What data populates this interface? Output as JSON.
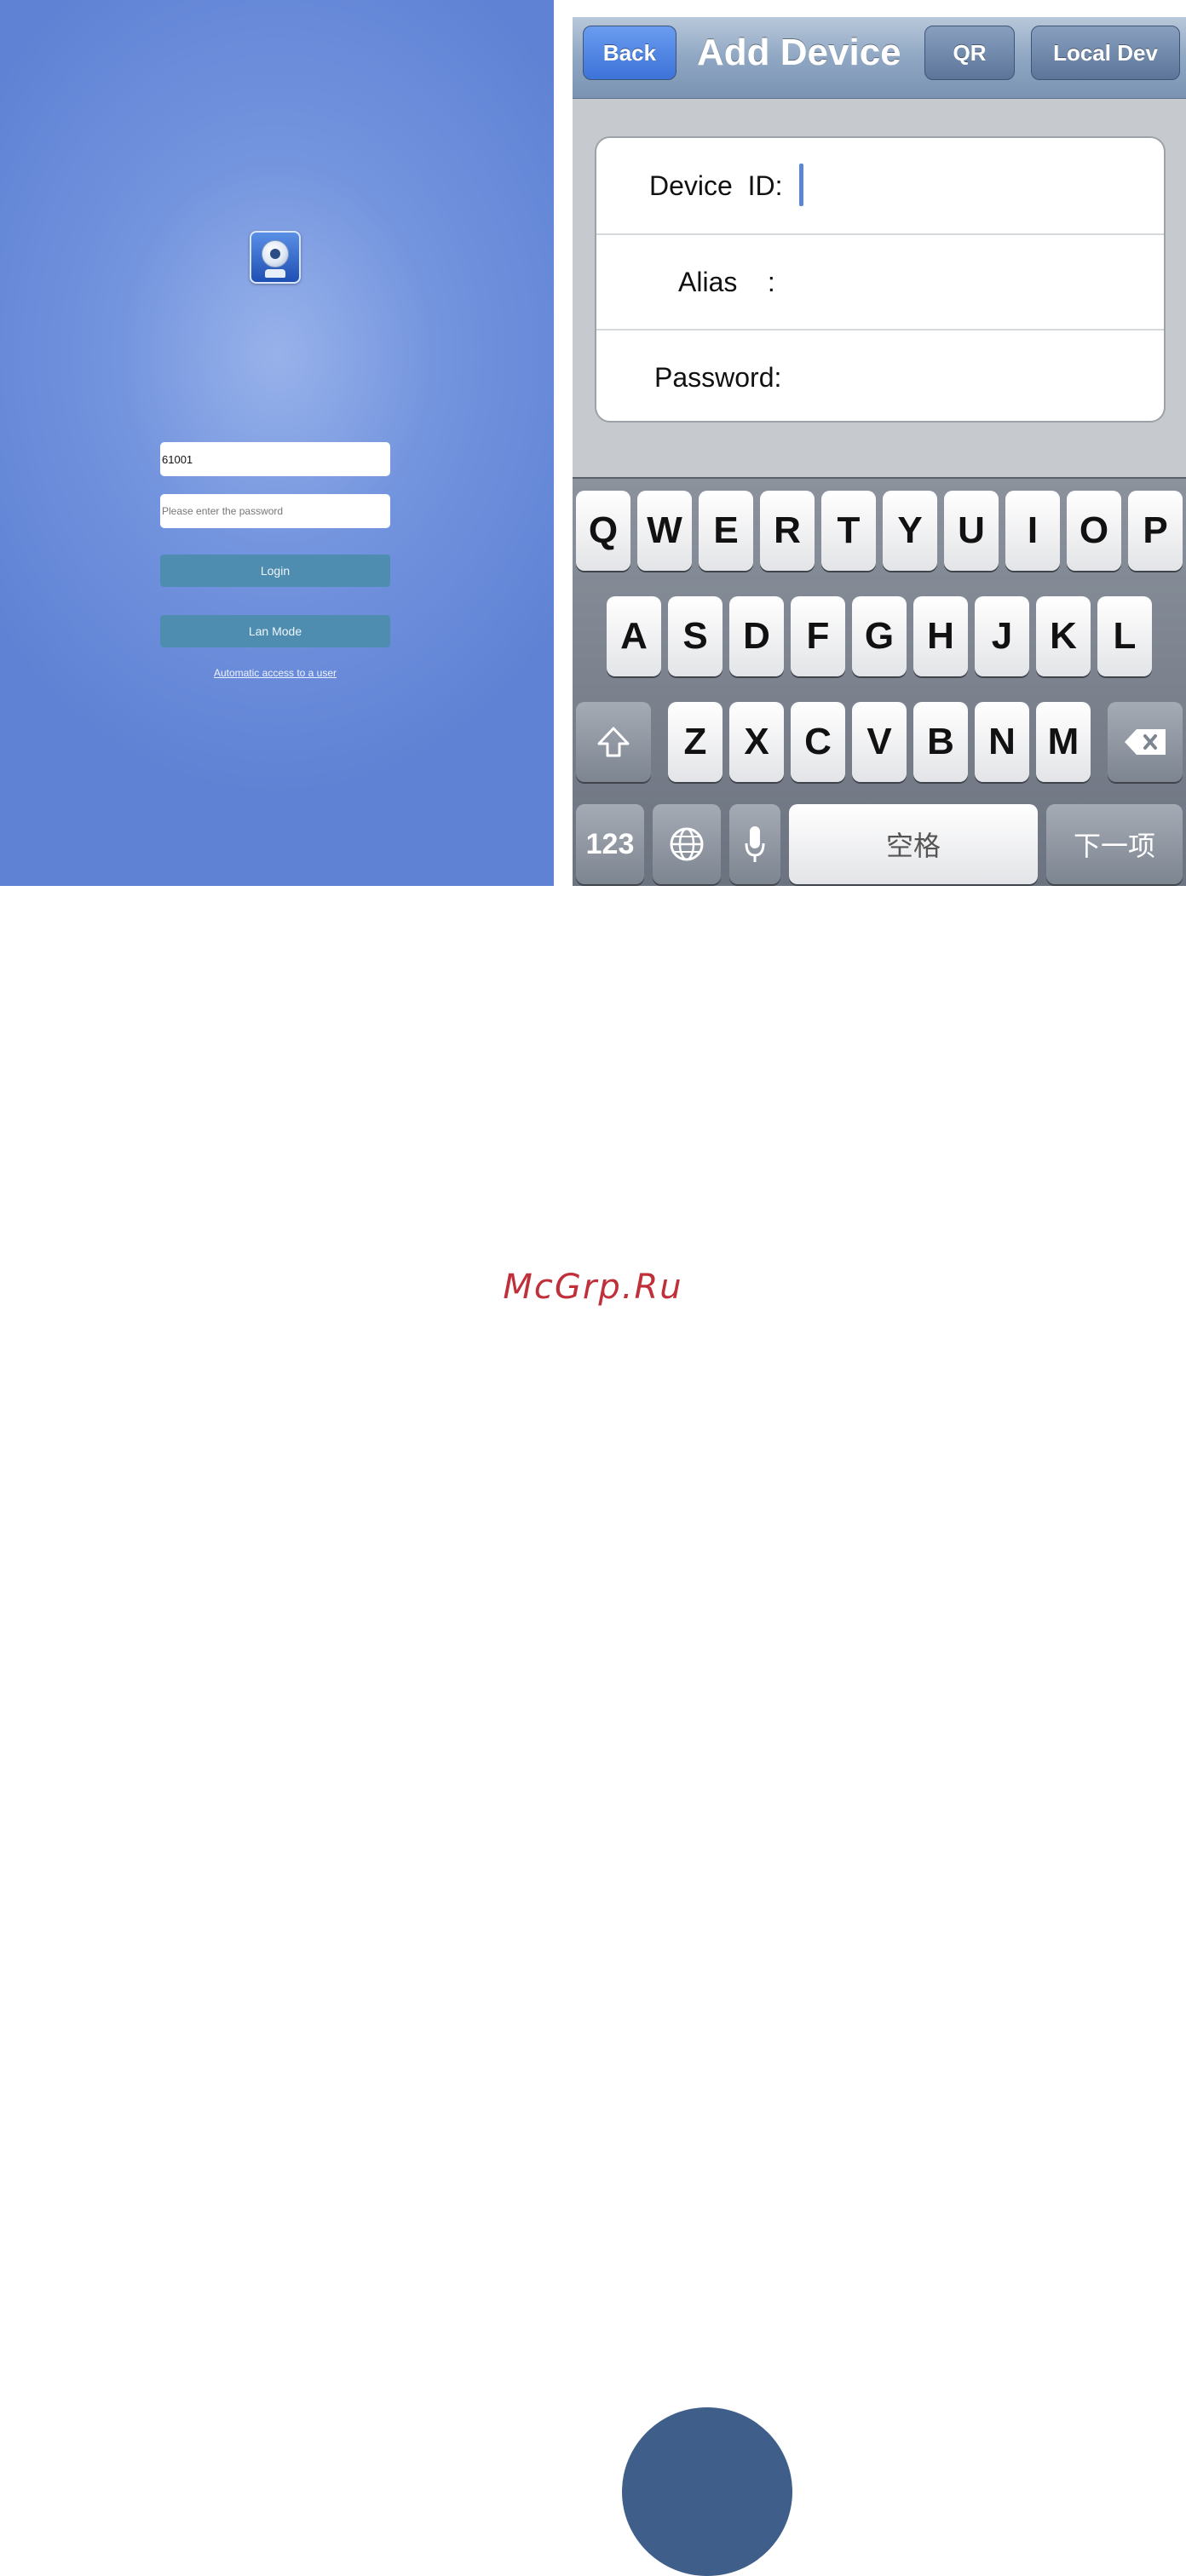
{
  "login_screen": {
    "app_icon": "webcam-icon",
    "username_value": "61001",
    "password_placeholder": "Please enter the password",
    "login_label": "Login",
    "lan_mode_label": "Lan Mode",
    "auto_access_label": "Automatic access to a user",
    "background_color": "#6b8ddb",
    "button_color": "#4f8db0"
  },
  "add_device_screen": {
    "nav": {
      "back_label": "Back",
      "title": "Add Device",
      "qr_label": "QR",
      "local_dev_label": "Local Dev"
    },
    "form": {
      "device_id_label": "Device  ID:",
      "alias_label": "Alias    :",
      "password_label": "Password:"
    },
    "keyboard": {
      "row1": [
        "Q",
        "W",
        "E",
        "R",
        "T",
        "Y",
        "U",
        "I",
        "O",
        "P"
      ],
      "row2": [
        "A",
        "S",
        "D",
        "F",
        "G",
        "H",
        "J",
        "K",
        "L"
      ],
      "row3": [
        "Z",
        "X",
        "C",
        "V",
        "B",
        "N",
        "M"
      ],
      "shift_icon": "shift-arrow-icon",
      "backspace_icon": "backspace-icon",
      "numbers_label": "123",
      "globe_icon": "globe-icon",
      "mic_icon": "microphone-icon",
      "space_label": "空格",
      "next_label": "下一项"
    }
  },
  "watermark": "McGrp.Ru"
}
